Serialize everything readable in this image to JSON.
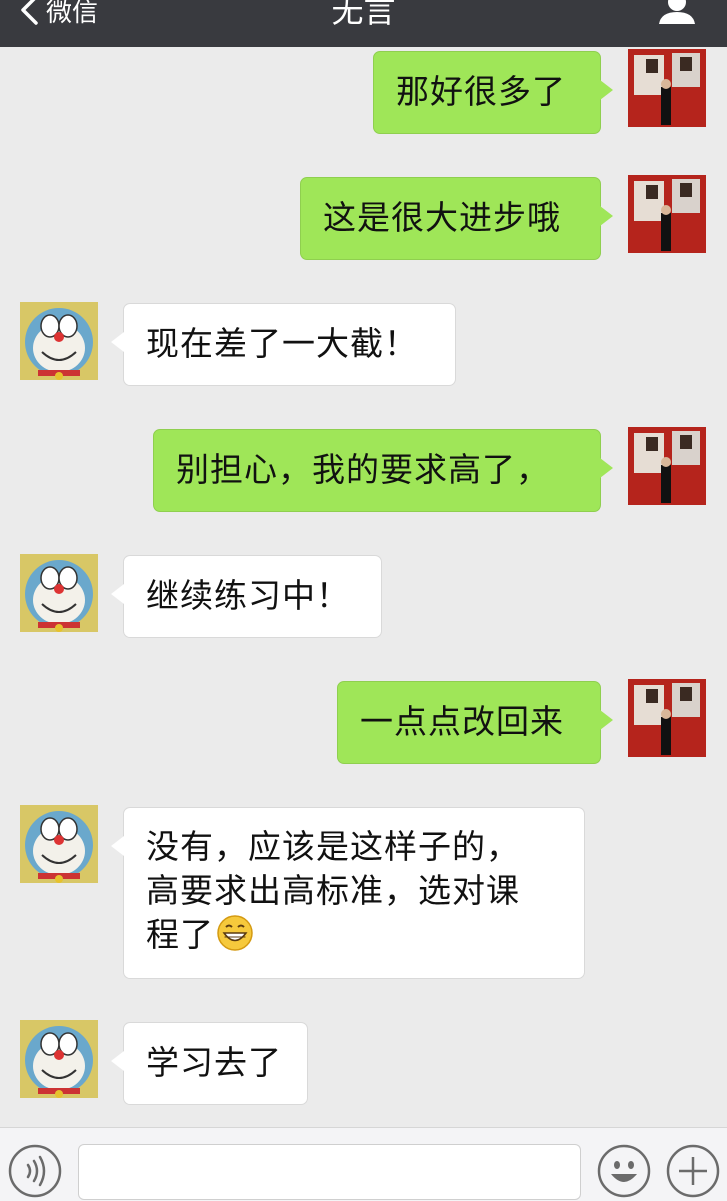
{
  "header": {
    "back_label": "微信",
    "title": "无言"
  },
  "messages": [
    {
      "from": "me",
      "text": "那好很多了"
    },
    {
      "from": "me",
      "text": "这是很大进步哦"
    },
    {
      "from": "friend",
      "text": "现在差了一大截！"
    },
    {
      "from": "me",
      "text": "别担心，我的要求高了，"
    },
    {
      "from": "friend",
      "text": "继续练习中！"
    },
    {
      "from": "me",
      "text": "一点点改回来"
    },
    {
      "from": "friend",
      "lines": [
        "没有，应该是这样子的，",
        "高要求出高标准，选对课",
        "程了"
      ],
      "trailing_icon": "grinning-emoji-icon"
    },
    {
      "from": "friend",
      "text": "学习去了"
    }
  ],
  "input": {
    "value": "",
    "placeholder": ""
  },
  "icons": {
    "back": "chevron-left-icon",
    "profile": "person-icon",
    "voice": "voice-icon",
    "emoji": "smiley-icon",
    "more": "plus-icon"
  },
  "colors": {
    "topbar": "#393a3f",
    "outgoing_bubble": "#9fe658",
    "incoming_bubble": "#ffffff",
    "background": "#ebebeb"
  }
}
